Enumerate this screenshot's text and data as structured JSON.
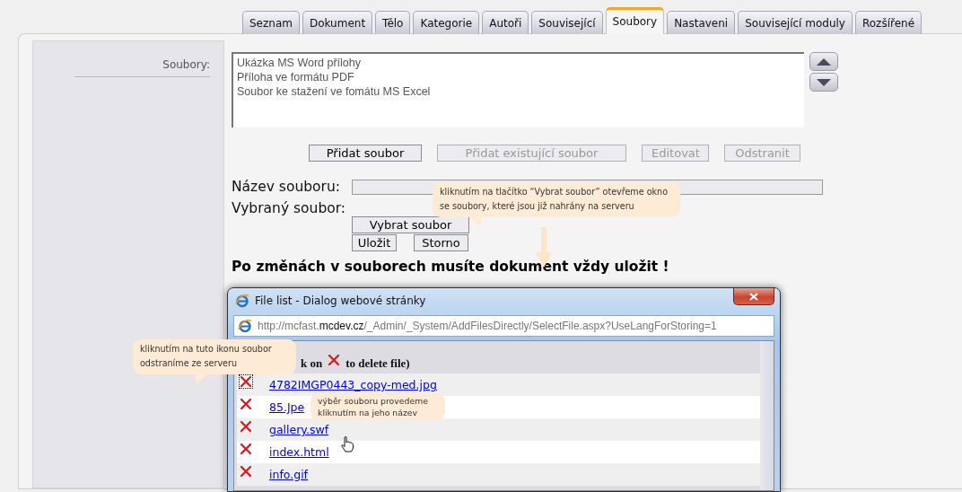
{
  "tabs": [
    {
      "label": "Seznam",
      "selected": false
    },
    {
      "label": "Dokument",
      "selected": false
    },
    {
      "label": "Tělo",
      "selected": false
    },
    {
      "label": "Kategorie",
      "selected": false
    },
    {
      "label": "Autoři",
      "selected": false
    },
    {
      "label": "Související",
      "selected": false
    },
    {
      "label": "Soubory",
      "selected": true
    },
    {
      "label": "Nastaveni",
      "selected": false
    },
    {
      "label": "Související moduly",
      "selected": false
    },
    {
      "label": "Rozšířené",
      "selected": false
    }
  ],
  "form": {
    "label": "Soubory:",
    "files": [
      "Ukázka MS Word přílohy",
      "Příloha ve formátu PDF",
      "Soubor ke stažení ve fomátu MS Excel"
    ],
    "buttons": [
      {
        "label": "Přidat soubor",
        "disabled": false
      },
      {
        "label": "Přidat existující soubor",
        "disabled": true
      },
      {
        "label": "Editovat",
        "disabled": true
      },
      {
        "label": "Odstranit",
        "disabled": true
      }
    ],
    "name_label": "Název souboru:",
    "selected_label": "Vybraný soubor:",
    "choose_button": "Vybrat soubor",
    "save_button": "Uložit",
    "cancel_button": "Storno",
    "warning": "Po změnách v souborech musíte dokument vždy uložit !"
  },
  "dialog": {
    "title": "File list - Dialog webové stránky",
    "url": "http://mcfast.**mcdev.cz**/_Admin/_System/AddFilesDirectly/SelectFile.aspx?UseLangForStoring=1",
    "hint_before": "k on",
    "hint_after": "to delete file)",
    "files": [
      {
        "name": "4782IMGP0443_copy-med.jpg",
        "focused": true
      },
      {
        "name": "85.Jpe",
        "focused": false
      },
      {
        "name": "gallery.swf",
        "focused": false
      },
      {
        "name": "index.html",
        "focused": false
      },
      {
        "name": "info.gif",
        "focused": false
      }
    ]
  },
  "callouts": [
    {
      "kind": "note-arrow",
      "text": "kliknutím na tlačítko “Vybrat soubor” otevřeme okno se soubory, které jsou již nahrány na serveru"
    },
    {
      "kind": "note",
      "text": "kliknutím na tuto ikonu soubor odstraníme ze serveru"
    },
    {
      "kind": "note",
      "text": "výběr souboru provedeme kliknutím na jeho název"
    }
  ]
}
